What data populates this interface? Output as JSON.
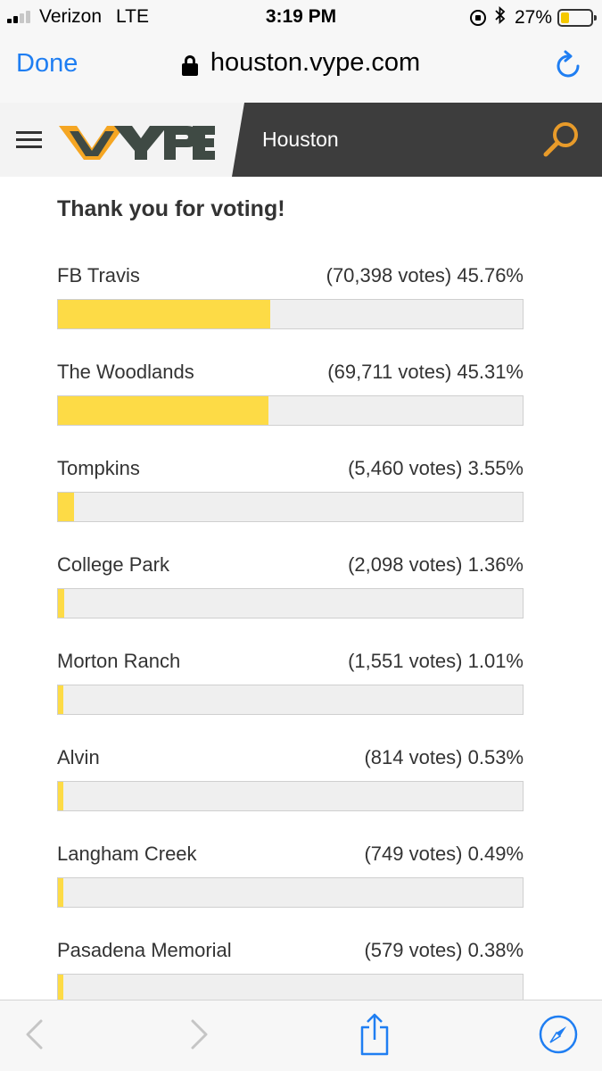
{
  "status_bar": {
    "carrier": "Verizon",
    "network": "LTE",
    "time": "3:19 PM",
    "battery_percent_label": "27%",
    "battery_level": 0.27,
    "signal_bars_filled": 2,
    "signal_bars_total": 4
  },
  "browser": {
    "done_label": "Done",
    "url": "houston.vype.com",
    "accent_color": "#1f7ef2"
  },
  "site": {
    "logo_text": "VYPE",
    "logo_accent": "#f5a623",
    "logo_color": "#3f4a44",
    "city": "Houston",
    "search_color": "#e89b2a"
  },
  "poll": {
    "title": "Thank you for voting!",
    "bar_color": "#fddb46",
    "rows": [
      {
        "name": "FB Travis",
        "votes": "(70,398 votes) 45.76%",
        "percent": 45.76
      },
      {
        "name": "The Woodlands",
        "votes": "(69,711 votes) 45.31%",
        "percent": 45.31
      },
      {
        "name": "Tompkins",
        "votes": "(5,460 votes) 3.55%",
        "percent": 3.55
      },
      {
        "name": "College Park",
        "votes": "(2,098 votes) 1.36%",
        "percent": 1.36
      },
      {
        "name": "Morton Ranch",
        "votes": "(1,551 votes) 1.01%",
        "percent": 1.01
      },
      {
        "name": "Alvin",
        "votes": "(814 votes) 0.53%",
        "percent": 0.53
      },
      {
        "name": "Langham Creek",
        "votes": "(749 votes) 0.49%",
        "percent": 0.49
      },
      {
        "name": "Pasadena Memorial",
        "votes": "(579 votes) 0.38%",
        "percent": 0.38
      }
    ]
  },
  "toolbar": {
    "items": [
      "back-icon",
      "forward-icon",
      "share-icon",
      "compass-icon"
    ]
  }
}
